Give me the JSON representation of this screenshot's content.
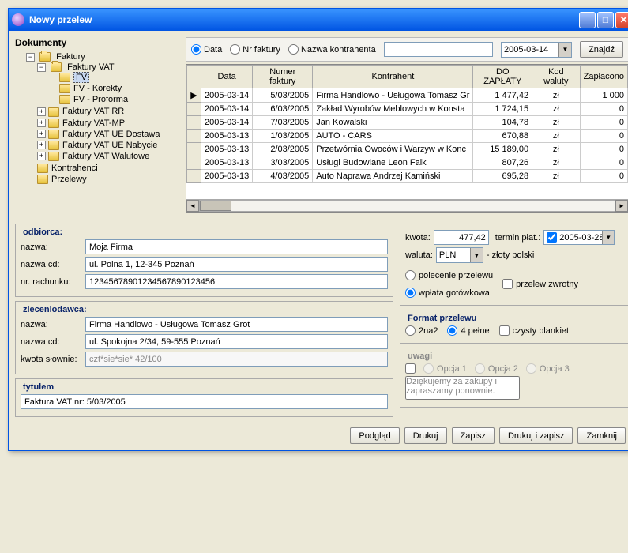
{
  "window": {
    "title": "Nowy przelew"
  },
  "documents_label": "Dokumenty",
  "tree": {
    "faktury": "Faktury",
    "faktury_vat": "Faktury VAT",
    "fv": "FV",
    "fv_korekty": "FV - Korekty",
    "fv_proforma": "FV - Proforma",
    "faktury_vat_rr": "Faktury VAT RR",
    "faktury_vat_mp": "Faktury VAT-MP",
    "faktury_vat_ue_dostawa": "Faktury VAT UE Dostawa",
    "faktury_vat_ue_nabycie": "Faktury VAT UE Nabycie",
    "faktury_vat_walutowe": "Faktury VAT Walutowe",
    "kontrahenci": "Kontrahenci",
    "przelewy": "Przelewy"
  },
  "filter": {
    "data_label": "Data",
    "nr_faktury_label": "Nr faktury",
    "nazwa_kontrahenta_label": "Nazwa kontrahenta",
    "date_value": "2005-03-14",
    "find_button": "Znajdź"
  },
  "grid": {
    "headers": {
      "data": "Data",
      "numer_faktury": "Numer faktury",
      "kontrahent": "Kontrahent",
      "do_zaplaty": "DO ZAPŁATY",
      "kod_waluty": "Kod waluty",
      "zaplacono": "Zapłacono"
    },
    "rows": [
      {
        "data": "2005-03-14",
        "nf": "5/03/2005",
        "k": "Firma Handlowo - Usługowa Tomasz Gr",
        "dz": "1 477,42",
        "kw": "zł",
        "zp": "1 000"
      },
      {
        "data": "2005-03-14",
        "nf": "6/03/2005",
        "k": "Zakład Wyrobów Meblowych w Konsta",
        "dz": "1 724,15",
        "kw": "zł",
        "zp": "0"
      },
      {
        "data": "2005-03-14",
        "nf": "7/03/2005",
        "k": "Jan Kowalski",
        "dz": "104,78",
        "kw": "zł",
        "zp": "0"
      },
      {
        "data": "2005-03-13",
        "nf": "1/03/2005",
        "k": "AUTO - CARS",
        "dz": "670,88",
        "kw": "zł",
        "zp": "0"
      },
      {
        "data": "2005-03-13",
        "nf": "2/03/2005",
        "k": "Przetwórnia Owoców i Warzyw w Konc",
        "dz": "15 189,00",
        "kw": "zł",
        "zp": "0"
      },
      {
        "data": "2005-03-13",
        "nf": "3/03/2005",
        "k": "Usługi Budowlane Leon Falk",
        "dz": "807,26",
        "kw": "zł",
        "zp": "0"
      },
      {
        "data": "2005-03-13",
        "nf": "4/03/2005",
        "k": "Auto Naprawa Andrzej Kamiński",
        "dz": "695,28",
        "kw": "zł",
        "zp": "0"
      }
    ]
  },
  "odbiorca": {
    "legend": "odbiorca:",
    "nazwa_label": "nazwa:",
    "nazwa": "Moja Firma",
    "nazwa_cd_label": "nazwa cd:",
    "nazwa_cd": "ul. Polna 1, 12-345 Poznań",
    "nr_rachunku_label": "nr. rachunku:",
    "nr_rachunku": "12345678901234567890123456"
  },
  "zleceniodawca": {
    "legend": "zleceniodawca:",
    "nazwa_label": "nazwa:",
    "nazwa": "Firma Handlowo - Usługowa Tomasz Grot",
    "nazwa_cd_label": "nazwa cd:",
    "nazwa_cd": "ul. Spokojna 2/34, 59-555 Poznań",
    "kwota_slownie_label": "kwota słownie:",
    "kwota_slownie": "czt*sie*sie* 42/100"
  },
  "tytulem": {
    "legend": "tytułem",
    "value": "Faktura VAT nr: 5/03/2005"
  },
  "right_panel": {
    "kwota_label": "kwota:",
    "kwota": "477,42",
    "termin_label": "termin płat.:",
    "termin": "2005-03-28",
    "waluta_label": "waluta:",
    "waluta": "PLN",
    "waluta_desc": "- złoty polski",
    "polecenie_przelewu": "polecenie przelewu",
    "wplata_gotowkowa": "wpłata gotówkowa",
    "przelew_zwrotny": "przelew zwrotny",
    "format_legend": "Format przelewu",
    "format_2na2": "2na2",
    "format_4pelne": "4 pełne",
    "czysty_blankiet": "czysty blankiet",
    "uwagi_legend": "uwagi",
    "opcja1": "Opcja 1",
    "opcja2": "Opcja 2",
    "opcja3": "Opcja 3",
    "uwagi_text": "Dziękujemy za zakupy i zapraszamy ponownie."
  },
  "buttons": {
    "podglad": "Podgląd",
    "drukuj": "Drukuj",
    "zapisz": "Zapisz",
    "drukuj_zapisz": "Drukuj i zapisz",
    "zamknij": "Zamknij"
  }
}
